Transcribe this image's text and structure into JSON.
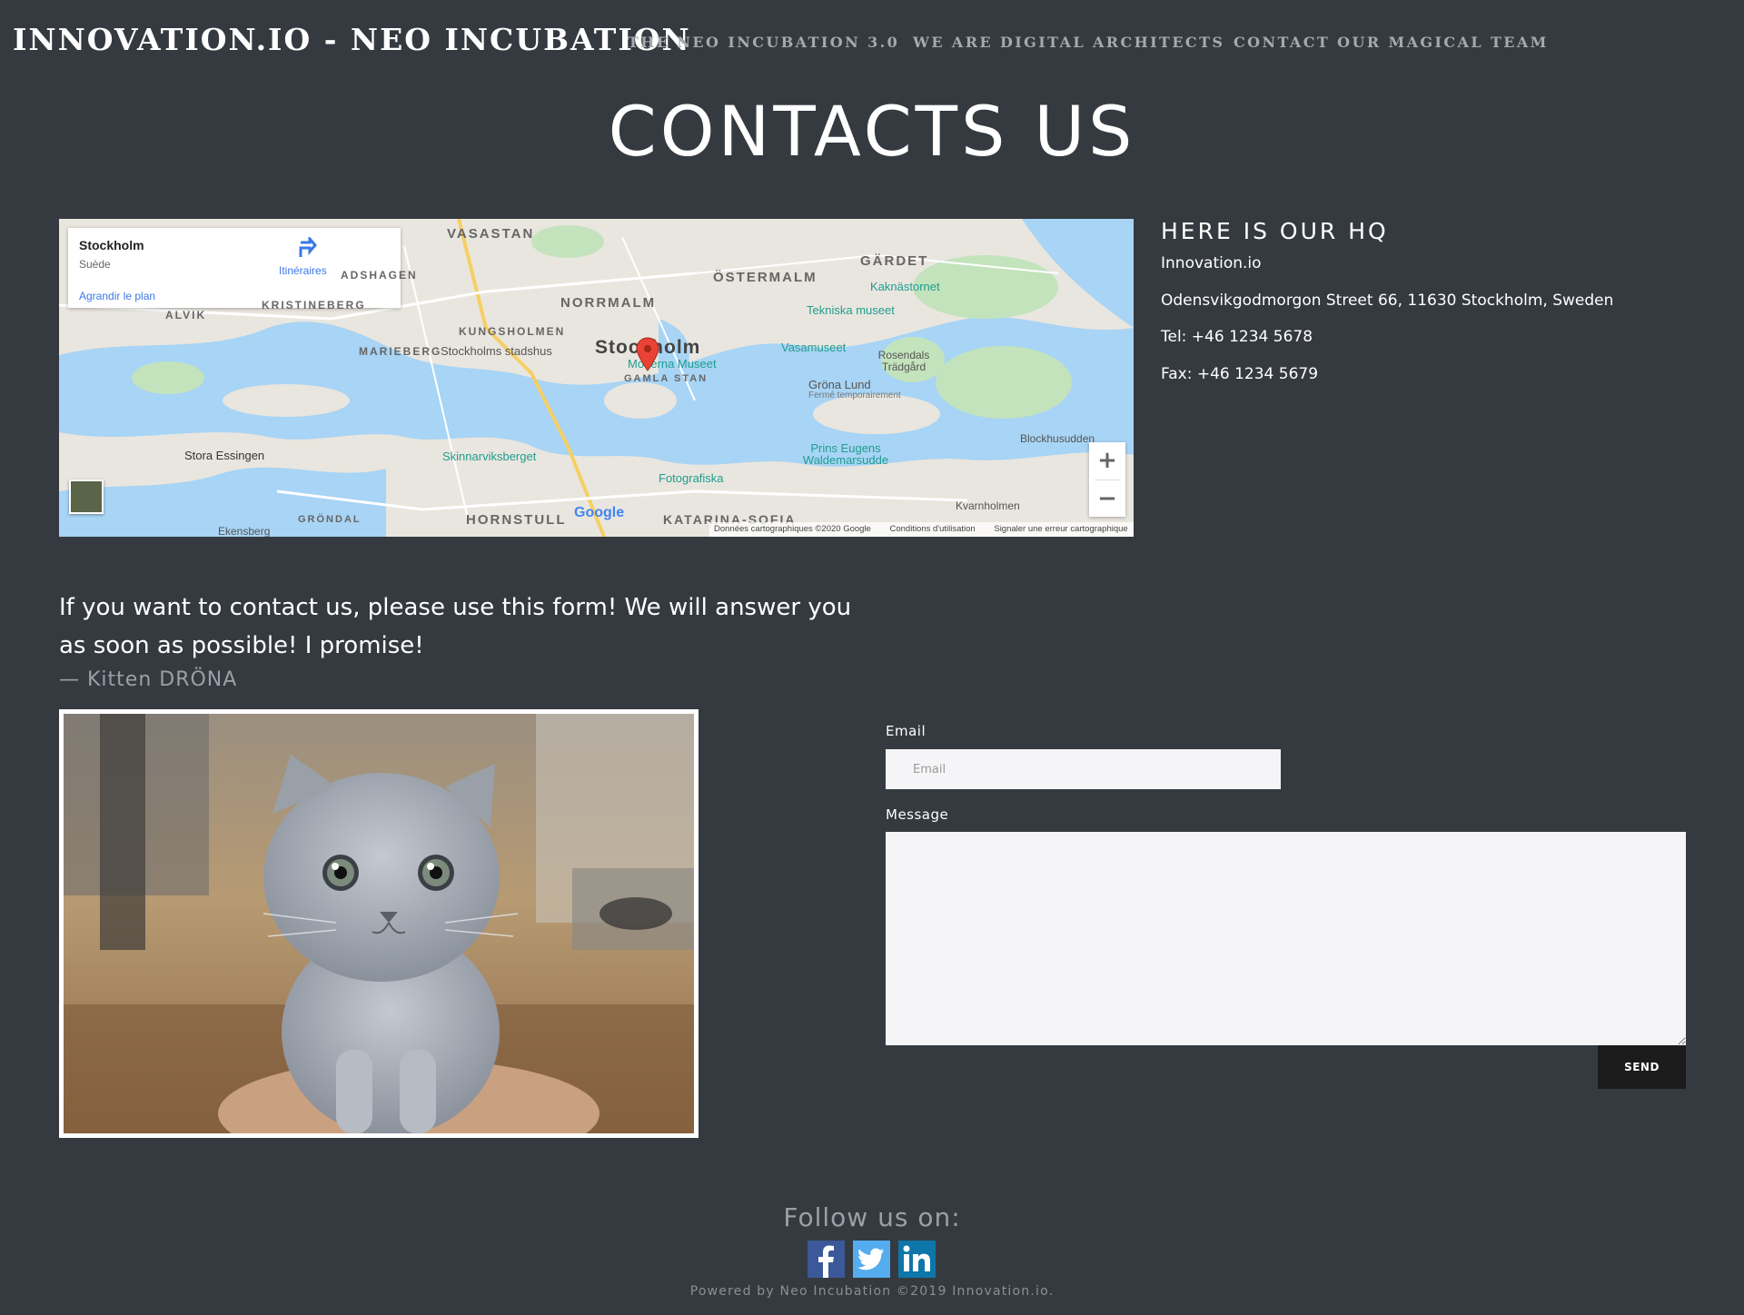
{
  "navbar": {
    "brand": "INNOVATION.IO - NEO INCUBATION",
    "links": [
      {
        "label": "THE NEO INCUBATION 3.0"
      },
      {
        "label": "WE ARE DIGITAL ARCHITECTS"
      },
      {
        "label": "CONTACT OUR MAGICAL TEAM"
      }
    ]
  },
  "page": {
    "title": "CONTACTS US"
  },
  "map": {
    "card": {
      "place": "Stockholm",
      "country": "Suède",
      "directions_label": "Itinéraires",
      "enlarge_label": "Agrandir le plan"
    },
    "labels": {
      "vasastan": "VASASTAN",
      "gardet": "GÄRDET",
      "ostermalm": "ÖSTERMALM",
      "norrmalm": "NORRMALM",
      "kristineberg": "KRISTINEBERG",
      "adshagen": "ADSHAGEN",
      "alvik": "ALVIK",
      "kungsholmen": "KUNGSHOLMEN",
      "marieberg": "MARIEBERG",
      "stadshus": "Stockholms stadshus",
      "city": "Stockholm",
      "moderna": "Moderna Museet",
      "gamla": "GAMLA STAN",
      "kaknas": "Kaknästornet",
      "tekniska": "Tekniska museet",
      "vasamuseet": "Vasamuseet",
      "rosendals": "Rosendals Trädgård",
      "grona": "Gröna Lund",
      "grona_note": "Fermé temporairement",
      "blockhus": "Blockhusudden",
      "prins": "Prins Eugens Waldemarsudde",
      "stora": "Stora Essingen",
      "skinnarvik": "Skinnarviksberget",
      "fotografiska": "Fotografiska",
      "grondal": "GRÖNDAL",
      "hornstull": "HORNSTULL",
      "katarina": "KATARINA-SOFIA",
      "kvarnholmen": "Kvarnholmen",
      "ekensberg": "Ekensberg",
      "google": "Google"
    },
    "zoom_in": "+",
    "zoom_out": "−",
    "footer": {
      "data": "Données cartographiques ©2020 Google",
      "terms": "Conditions d'utilisation",
      "report": "Signaler une erreur cartographique"
    }
  },
  "hq": {
    "title": "HERE IS OUR HQ",
    "company": "Innovation.io",
    "address": "Odensvikgodmorgon Street 66, 11630 Stockholm, Sweden",
    "tel": "Tel: +46 1234 5678",
    "fax": "Fax: +46 1234 5679"
  },
  "quote": {
    "text": "If you want to contact us, please use this form! We will answer you as soon as possible! I promise!",
    "author": "— Kitten DRÖNA"
  },
  "form": {
    "email_label": "Email",
    "email_placeholder": "Email",
    "email_value": "",
    "message_label": "Message",
    "message_value": "",
    "send_label": "SEND"
  },
  "footer": {
    "follow_text": "Follow us on:",
    "social": [
      {
        "name": "facebook-icon",
        "color": "#3b5998"
      },
      {
        "name": "twitter-icon",
        "color": "#55acee"
      },
      {
        "name": "linkedin-icon",
        "color": "#0e76a8"
      }
    ],
    "powered": "Powered by Neo Incubation ©2019 Innovation.io."
  }
}
